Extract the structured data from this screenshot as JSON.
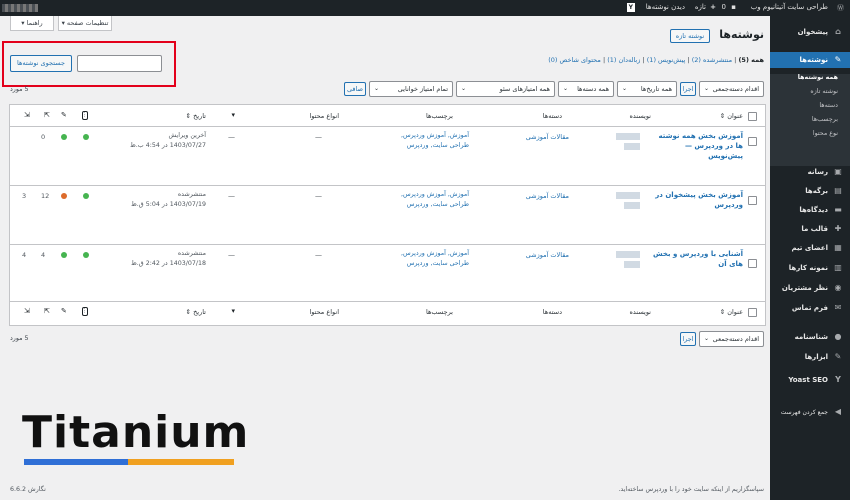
{
  "adminbar": {
    "site_name": "طراحی سایت آتیتانیوم وب",
    "view_posts": "دیدن نوشته‌ها",
    "new": "تازه",
    "comments": "0",
    "plus": "+",
    "yoast": "Y"
  },
  "sidebar": {
    "items": [
      {
        "label": "پیشخوان",
        "icon": "⌂"
      },
      {
        "label": "نوشته‌ها",
        "icon": "✎"
      },
      {
        "label": "رسانه",
        "icon": "▣"
      },
      {
        "label": "برگه‌ها",
        "icon": "▤"
      },
      {
        "label": "دیدگاه‌ها",
        "icon": "▬"
      },
      {
        "label": "قالب ما",
        "icon": "✚"
      },
      {
        "label": "اعضای تیم",
        "icon": "▦"
      },
      {
        "label": "نمونه کارها",
        "icon": "▥"
      },
      {
        "label": "نظر مشتریان",
        "icon": "◉"
      },
      {
        "label": "فرم تماس",
        "icon": "✉"
      },
      {
        "label": "شناسنامه",
        "icon": "●"
      },
      {
        "label": "ابزارها",
        "icon": "✎"
      },
      {
        "label": "Yoast SEO",
        "icon": "Y"
      },
      {
        "label": "جمع کردن فهرست",
        "icon": "◀"
      }
    ],
    "submenu": [
      "همه نوشته‌ها",
      "نوشته تازه",
      "دسته‌ها",
      "برچسب‌ها",
      "نوع محتوا"
    ]
  },
  "top_buttons": {
    "screen_options": "تنظیمات صفحه",
    "help": "راهنما"
  },
  "page": {
    "title": "نوشته‌ها",
    "add_new": "نوشته تازه"
  },
  "filters_links": {
    "all": "همه (5)",
    "published": "منتشرشده (2)",
    "draft": "پیش‌نویس (1)",
    "trash": "زباله‌دان (1)",
    "cornerstone": "محتوای شاخص (0)",
    "sep": "|"
  },
  "search": {
    "button": "جستجوی نوشته‌ها",
    "value": ""
  },
  "bulk": {
    "action": "اقدام دسته‌جمعی",
    "apply": "اجرا",
    "all_dates": "همه تاریخ‌ها",
    "all_categories": "همه دسته‌ها",
    "seo_scores": "همه امتیازهای سئو",
    "readability": "تمام امتیاز خوانایی",
    "filter": "صافی",
    "count": "5 مورد"
  },
  "columns": {
    "title": "عنوان",
    "author": "نویسنده",
    "categories": "دسته‌ها",
    "tags": "برچسب‌ها",
    "content_type": "انواع محتوا",
    "date": "تاریخ"
  },
  "rows": [
    {
      "title": "آموزش بخش همه نوشته ها در وردپرس — پیش‌نویس",
      "category": "مقالات آموزشی",
      "tags": "آموزش, آموزش وردپرس, طراحی سایت, وردپرس",
      "type": "—",
      "date_status": "آخرین ویرایش",
      "date": "1403/07/27 در 4:54 ب.ظ",
      "n1": "0",
      "seo": "#46b450",
      "read": "#46b450",
      "dash": "—"
    },
    {
      "title": "آموزش بخش پیشخوان در وردپرس",
      "category": "مقالات آموزشی",
      "tags": "آموزش, آموزش وردپرس, طراحی سایت, وردپرس",
      "type": "—",
      "date_status": "منتشرشده",
      "date": "1403/07/19 در 5:04 ق.ظ",
      "n1": "12",
      "n2": "3",
      "seo": "#46b450",
      "read": "#dd6b2b",
      "dash": "—"
    },
    {
      "title": "آشنایی با وردپرس و بخش های آن",
      "category": "مقالات آموزشی",
      "tags": "آموزش, آموزش وردپرس, طراحی سایت, وردپرس",
      "type": "—",
      "date_status": "منتشرشده",
      "date": "1403/07/18 در 2:42 ق.ظ",
      "n1": "4",
      "n2": "4",
      "seo": "#46b450",
      "read": "#46b450",
      "dash": "—"
    }
  ],
  "footer": {
    "thanks": "سپاسگزاریم از اینکه سایت خود را با وردپرس ساخته‌اید.",
    "wp_link": "وردپرس",
    "version": "نگارش 6.6.2"
  },
  "brand": {
    "name": "Titanium",
    "bar_blue": "#2f6fd6",
    "bar_orange": "#f0a020"
  },
  "colors": {
    "accent": "#2271b1",
    "highlight": "#e3001b"
  }
}
